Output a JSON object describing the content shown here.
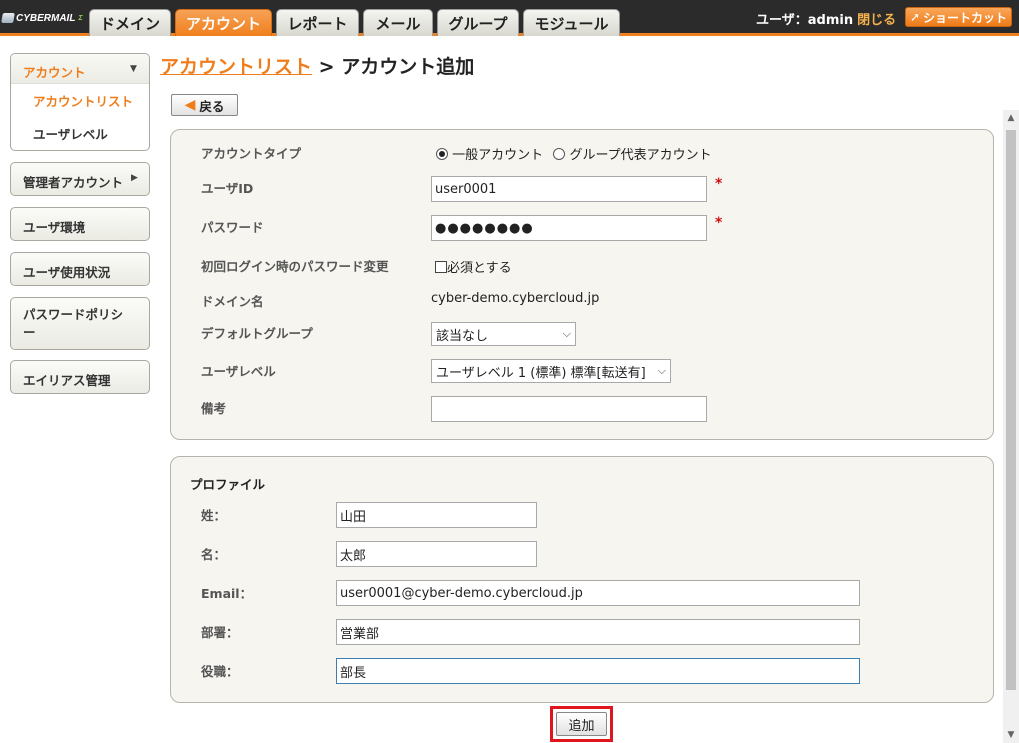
{
  "logo": {
    "text": "CYBERMAIL",
    "suffix": "Σ"
  },
  "tabs": [
    {
      "label": "ドメイン",
      "active": false
    },
    {
      "label": "アカウント",
      "active": true
    },
    {
      "label": "レポート",
      "active": false
    },
    {
      "label": "メール",
      "active": false
    },
    {
      "label": "グループ",
      "active": false
    },
    {
      "label": "モジュール",
      "active": false
    }
  ],
  "header": {
    "user_label": "ユーザ：admin",
    "close_label": "閉じる",
    "shortcut_label": "ショートカット"
  },
  "sidebar": {
    "open_group": {
      "label": "アカウント",
      "items": [
        "アカウントリスト",
        "ユーザレベル"
      ]
    },
    "items": [
      {
        "label": "管理者アカウント"
      },
      {
        "label": "ユーザ環境"
      },
      {
        "label": "ユーザ使用状況"
      },
      {
        "label": "パスワードポリシー"
      },
      {
        "label": "エイリアス管理"
      }
    ]
  },
  "breadcrumb": {
    "link": "アカウントリスト",
    "separator": ">",
    "current": "アカウント追加"
  },
  "back_button": "戻る",
  "account_form": {
    "account_type": {
      "label": "アカウントタイプ",
      "options": [
        "一般アカウント",
        "グループ代表アカウント"
      ],
      "selected": "一般アカウント"
    },
    "user_id": {
      "label": "ユーザID",
      "value": "user0001",
      "required_mark": "*"
    },
    "password": {
      "label": "パスワード",
      "value": "●●●●●●●●",
      "required_mark": "*"
    },
    "first_login_change": {
      "label": "初回ログイン時のパスワード変更",
      "checkbox_label": "必須とする",
      "checked": false
    },
    "domain": {
      "label": "ドメイン名",
      "value": "cyber-demo.cybercloud.jp"
    },
    "default_group": {
      "label": "デフォルトグループ",
      "value": "該当なし"
    },
    "user_level": {
      "label": "ユーザレベル",
      "value": "ユーザレベル 1 (標準) 標準[転送有]"
    },
    "note": {
      "label": "備考",
      "value": ""
    }
  },
  "profile_form": {
    "title": "プロファイル",
    "last_name": {
      "label": "姓：",
      "value": "山田"
    },
    "first_name": {
      "label": "名：",
      "value": "太郎"
    },
    "email": {
      "label": "Email：",
      "value": "user0001@cyber-demo.cybercloud.jp"
    },
    "department": {
      "label": "部署：",
      "value": "営業部"
    },
    "position": {
      "label": "役職：",
      "value": "部長"
    }
  },
  "add_button": "追加",
  "colors": {
    "accent": "#f07f1d",
    "topbar": "#2b2b2b",
    "required": "#d01010",
    "highlight_box": "#e0161e"
  }
}
